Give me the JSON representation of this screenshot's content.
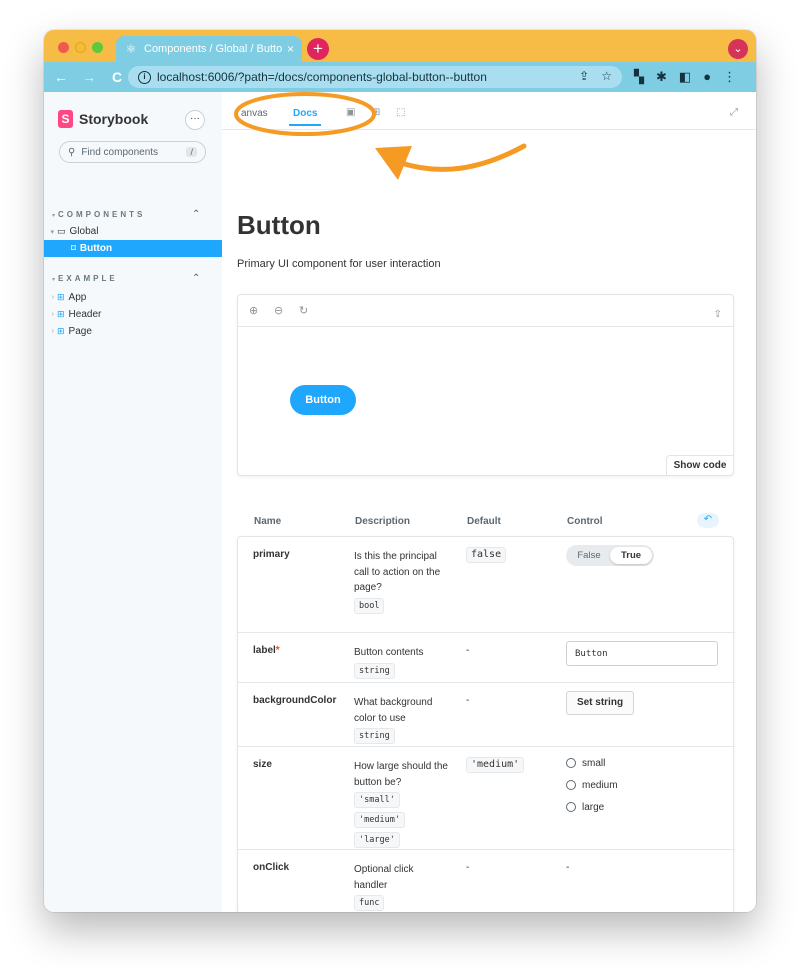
{
  "browser": {
    "tab_title": "Components / Global / Button",
    "tab_close": "×",
    "new_tab": "+",
    "url": "localhost:6006/?path=/docs/components-global-button--button",
    "nav": {
      "back": "←",
      "forward": "→",
      "reload": "C"
    }
  },
  "sidebar": {
    "logo_mark": "S",
    "logo_text": "Storybook",
    "menu_label": "···",
    "search_placeholder": "Find components",
    "search_shortcut": "/",
    "groups": [
      {
        "title": "COMPONENTS",
        "toggle": "⌃"
      },
      {
        "title": "EXAMPLE",
        "toggle": "⌃"
      }
    ],
    "items": [
      {
        "label": "Global"
      },
      {
        "label": "Button"
      },
      {
        "label": "App"
      },
      {
        "label": "Header"
      },
      {
        "label": "Page"
      }
    ]
  },
  "toolbar": {
    "tabs": [
      {
        "label": "anvas"
      },
      {
        "label": "Docs"
      }
    ],
    "active_tab": "Docs"
  },
  "docs": {
    "title": "Button",
    "subtitle": "Primary UI component for user interaction",
    "preview_button": "Button",
    "show_code": "Show code"
  },
  "args_table": {
    "headers": {
      "name": "Name",
      "description": "Description",
      "default": "Default",
      "control": "Control"
    },
    "rows": [
      {
        "name": "primary",
        "description": "Is this the principal call to action on the page?",
        "type": "bool",
        "default": "false",
        "control": {
          "off": "False",
          "on": "True"
        }
      },
      {
        "name": "label",
        "required_mark": "*",
        "description": "Button contents",
        "type": "string",
        "default": "-",
        "control_value": "Button"
      },
      {
        "name": "backgroundColor",
        "description": "What background color to use",
        "type": "string",
        "default": "-",
        "control_label": "Set string"
      },
      {
        "name": "size",
        "description": "How large should the button be?",
        "types": [
          "'small'",
          "'medium'",
          "'large'"
        ],
        "default": "'medium'",
        "options": [
          "small",
          "medium",
          "large"
        ]
      },
      {
        "name": "onClick",
        "description": "Optional click handler",
        "type": "func",
        "default": "-",
        "control_text": "-"
      }
    ]
  },
  "colors": {
    "accent": "#1ea7fd",
    "brand": "#ff4785",
    "titlebar": "#f7bc45",
    "addressbar": "#7fcde3",
    "annotation": "#f59a23"
  }
}
